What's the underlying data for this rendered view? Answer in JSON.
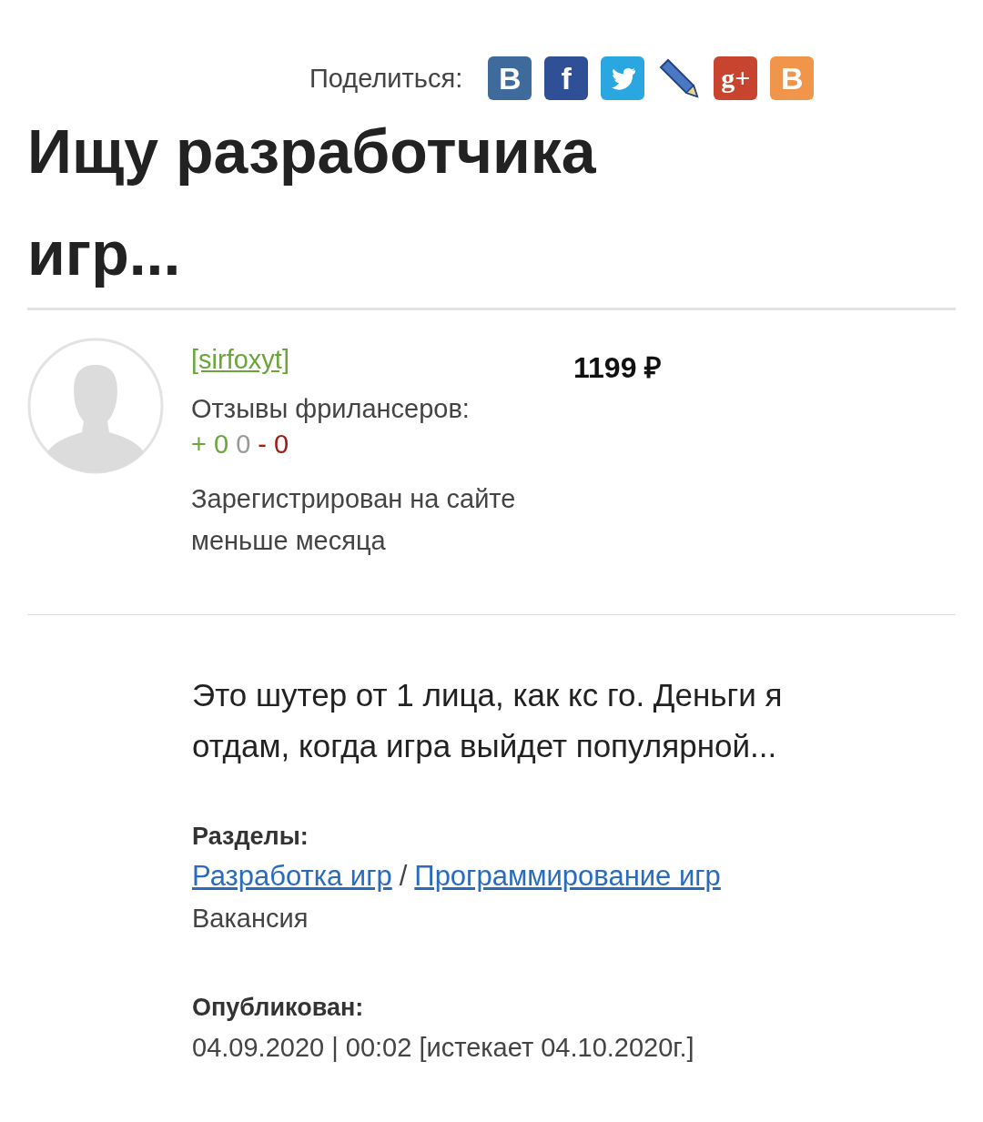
{
  "title": "Ищу разработчика игр...",
  "share": {
    "label": "Поделиться:",
    "buttons": [
      {
        "kind": "vk",
        "glyph": "B"
      },
      {
        "kind": "facebook",
        "glyph": "f"
      },
      {
        "kind": "twitter"
      },
      {
        "kind": "pencil"
      },
      {
        "kind": "gplus",
        "glyph": "g+"
      },
      {
        "kind": "blogger",
        "glyph": "B"
      }
    ]
  },
  "author": {
    "username": "[sirfoxyt]",
    "reviews_label": "Отзывы фрилансеров:",
    "reviews": [
      {
        "text": "+ 0",
        "color": "#6aa63a"
      },
      {
        "text": "0",
        "color": "#999999"
      },
      {
        "text": "- 0",
        "color": "#a01c10"
      }
    ],
    "registered": "Зарегистрирован на сайте меньше месяца"
  },
  "price": "1199 ₽",
  "description": "Это шутер от 1 лица, как кс го. Деньги я отдам, когда игра выйдет популярной...",
  "sections": {
    "label": "Разделы:",
    "links": [
      "Разработка игр",
      "Программирование игр"
    ],
    "separator": "/",
    "type": "Вакансия"
  },
  "published": {
    "label": "Опубликован:",
    "value": "04.09.2020 | 00:02 [истекает 04.10.2020г.]"
  }
}
